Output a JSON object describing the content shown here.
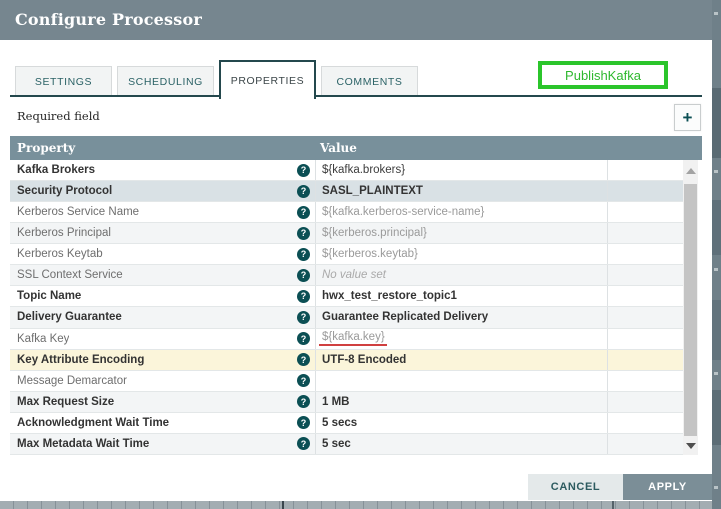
{
  "dialog": {
    "title": "Configure Processor"
  },
  "annotation": {
    "label": "PublishKafka"
  },
  "tabs": [
    {
      "label": "SETTINGS",
      "active": false
    },
    {
      "label": "SCHEDULING",
      "active": false
    },
    {
      "label": "PROPERTIES",
      "active": true
    },
    {
      "label": "COMMENTS",
      "active": false
    }
  ],
  "toolbar": {
    "required_label": "Required field",
    "add_label": "+"
  },
  "table": {
    "headers": {
      "property": "Property",
      "value": "Value"
    },
    "help_icon_glyph": "?",
    "rows": [
      {
        "name": "Kafka Brokers",
        "required": true,
        "bg": "white",
        "value": "${kafka.brokers}",
        "value_style": "dark"
      },
      {
        "name": "Security Protocol",
        "required": true,
        "bg": "selected",
        "value": "SASL_PLAINTEXT",
        "value_style": "bold"
      },
      {
        "name": "Kerberos Service Name",
        "required": false,
        "bg": "white",
        "value": "${kafka.kerberos-service-name}",
        "value_style": "gray"
      },
      {
        "name": "Kerberos Principal",
        "required": false,
        "bg": "stripe",
        "value": "${kerberos.principal}",
        "value_style": "gray"
      },
      {
        "name": "Kerberos Keytab",
        "required": false,
        "bg": "white",
        "value": "${kerberos.keytab}",
        "value_style": "gray"
      },
      {
        "name": "SSL Context Service",
        "required": false,
        "bg": "stripe",
        "value": "No value set",
        "value_style": "placeholder"
      },
      {
        "name": "Topic Name",
        "required": true,
        "bg": "white",
        "value": "hwx_test_restore_topic1",
        "value_style": "bold"
      },
      {
        "name": "Delivery Guarantee",
        "required": true,
        "bg": "stripe",
        "value": "Guarantee Replicated Delivery",
        "value_style": "bold"
      },
      {
        "name": "Kafka Key",
        "required": false,
        "bg": "white",
        "value": "${kafka.key}",
        "value_style": "underlined"
      },
      {
        "name": "Key Attribute Encoding",
        "required": true,
        "bg": "highlight",
        "value": "UTF-8 Encoded",
        "value_style": "bold"
      },
      {
        "name": "Message Demarcator",
        "required": false,
        "bg": "white",
        "value": "",
        "value_style": "gray"
      },
      {
        "name": "Max Request Size",
        "required": true,
        "bg": "stripe",
        "value": "1 MB",
        "value_style": "bold"
      },
      {
        "name": "Acknowledgment Wait Time",
        "required": true,
        "bg": "white",
        "value": "5 secs",
        "value_style": "bold"
      },
      {
        "name": "Max Metadata Wait Time",
        "required": true,
        "bg": "stripe",
        "value": "5 sec",
        "value_style": "bold"
      }
    ]
  },
  "footer": {
    "cancel": "CANCEL",
    "apply": "APPLY"
  },
  "colors": {
    "titlebar_bg": "#76868f",
    "table_header_bg": "#78909b",
    "accent_teal": "#0b4f54",
    "tab_border_active": "#24484d",
    "selected_row_bg": "#d9e1e5",
    "stripe_row_bg": "#f3f5f6",
    "highlight_row_bg": "#fbf5da",
    "annotation_green": "#2bc52b",
    "annotation_red_underline": "#d04040",
    "apply_bg": "#7b8e97",
    "cancel_bg": "#e4e9ea"
  }
}
